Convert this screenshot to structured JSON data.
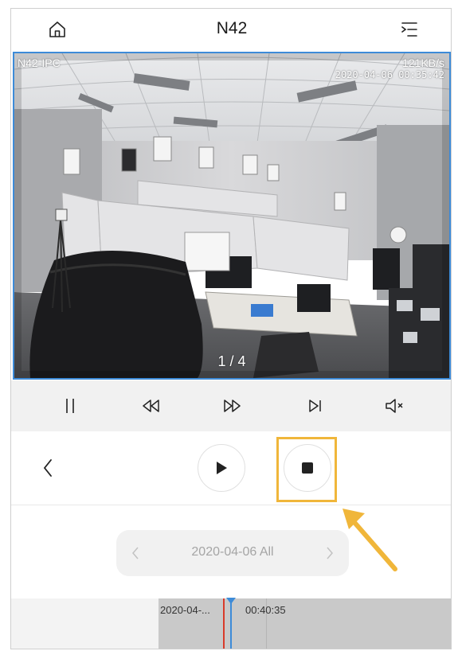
{
  "header": {
    "title": "N42",
    "home_icon": "home-icon",
    "menu_icon": "list-menu-icon"
  },
  "video": {
    "channel_name": "N42-IPC",
    "bitrate": "121KB/s",
    "timestamp": "2020-04-06 00:35:42",
    "page_indicator": "1 / 4",
    "border_color": "#3d8bd8"
  },
  "controls": {
    "pause_icon": "pause-icon",
    "rewind_icon": "rewind-icon",
    "fast_forward_icon": "fast-forward-icon",
    "next_frame_icon": "step-forward-icon",
    "mute_icon": "speaker-muted-icon"
  },
  "playback": {
    "back_icon": "chevron-left-icon",
    "play_icon": "play-icon",
    "stop_icon": "stop-icon",
    "highlight_color": "#f0b63a"
  },
  "date_selector": {
    "label": "2020-04-06  All",
    "prev_icon": "chevron-left-icon",
    "next_icon": "chevron-right-icon"
  },
  "timeline": {
    "date_label": "2020-04-...",
    "time_label": "00:40:35",
    "cursor_color": "#3d8bd8",
    "marker_color": "#d93a2a"
  }
}
